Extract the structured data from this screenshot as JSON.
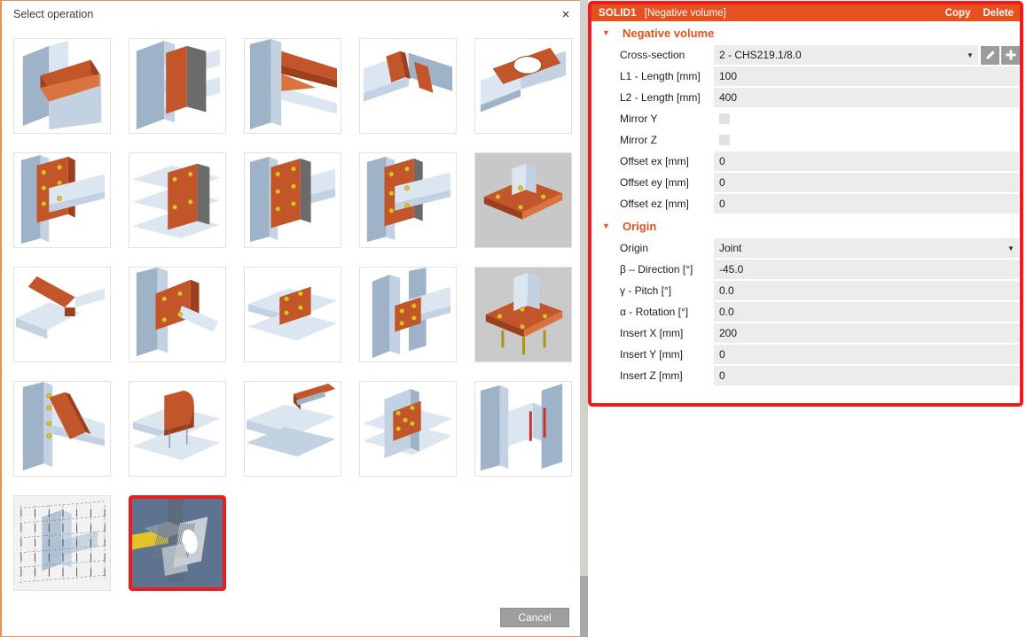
{
  "dialog": {
    "title": "Select operation",
    "close_label": "×",
    "cancel_label": "Cancel",
    "thumbnails": [
      {
        "id": "cut-beam-by-beam",
        "name": "cut-beam-by-beam",
        "selected": false
      },
      {
        "id": "plate-to-web",
        "name": "plate-to-web",
        "selected": false
      },
      {
        "id": "haunch-stiffener",
        "name": "haunch-stiffener",
        "selected": false
      },
      {
        "id": "stiffener-pair",
        "name": "stiffener-pair",
        "selected": false
      },
      {
        "id": "opening-in-web",
        "name": "opening-in-web",
        "selected": false
      },
      {
        "id": "end-plate-bolted",
        "name": "end-plate-bolted",
        "selected": false
      },
      {
        "id": "fin-plate-double",
        "name": "fin-plate-double",
        "selected": false
      },
      {
        "id": "bolted-splice-plate",
        "name": "bolted-splice-plate",
        "selected": false
      },
      {
        "id": "end-plate-column",
        "name": "end-plate-column",
        "selected": false
      },
      {
        "id": "base-plate-anchors",
        "name": "base-plate-anchors",
        "selected": false
      },
      {
        "id": "diagonal-gusset",
        "name": "diagonal-gusset",
        "selected": false
      },
      {
        "id": "gusset-plate-brace",
        "name": "gusset-plate-brace",
        "selected": false
      },
      {
        "id": "flange-cleat",
        "name": "flange-cleat",
        "selected": false
      },
      {
        "id": "splice-bolted-web",
        "name": "splice-bolted-web",
        "selected": false
      },
      {
        "id": "column-base-plate",
        "name": "column-base-plate",
        "selected": false
      },
      {
        "id": "diagonal-stiffener",
        "name": "diagonal-stiffener",
        "selected": false
      },
      {
        "id": "curved-end-plate",
        "name": "curved-end-plate",
        "selected": false
      },
      {
        "id": "cap-plate",
        "name": "cap-plate",
        "selected": false
      },
      {
        "id": "bolted-crossing",
        "name": "bolted-crossing",
        "selected": false
      },
      {
        "id": "web-plate-pair",
        "name": "web-plate-pair",
        "selected": false
      },
      {
        "id": "mesh-model",
        "name": "mesh-model",
        "selected": false
      },
      {
        "id": "negative-volume",
        "name": "negative-volume",
        "selected": true
      }
    ]
  },
  "properties": {
    "header": {
      "id": "SOLID1",
      "type": "[Negative volume]",
      "copy_label": "Copy",
      "delete_label": "Delete"
    },
    "groups": [
      {
        "title": "Negative volume",
        "expanded": true,
        "rows": [
          {
            "label": "Cross-section",
            "value": "2 - CHS219.1/8.0",
            "type": "combo-buttons"
          },
          {
            "label": "L1 - Length [mm]",
            "value": "100",
            "type": "text"
          },
          {
            "label": "L2 - Length [mm]",
            "value": "400",
            "type": "text"
          },
          {
            "label": "Mirror Y",
            "value": "",
            "type": "checkbox",
            "checked": false
          },
          {
            "label": "Mirror Z",
            "value": "",
            "type": "checkbox",
            "checked": false
          },
          {
            "label": "Offset ex [mm]",
            "value": "0",
            "type": "text"
          },
          {
            "label": "Offset ey [mm]",
            "value": "0",
            "type": "text"
          },
          {
            "label": "Offset ez [mm]",
            "value": "0",
            "type": "text"
          }
        ]
      },
      {
        "title": "Origin",
        "expanded": true,
        "rows": [
          {
            "label": "Origin",
            "value": "Joint",
            "type": "combo"
          },
          {
            "label": "β – Direction [°]",
            "value": "-45.0",
            "type": "text"
          },
          {
            "label": "γ - Pitch [°]",
            "value": "0.0",
            "type": "text"
          },
          {
            "label": "α - Rotation [°]",
            "value": "0.0",
            "type": "text"
          },
          {
            "label": "Insert X [mm]",
            "value": "200",
            "type": "text"
          },
          {
            "label": "Insert Y [mm]",
            "value": "0",
            "type": "text"
          },
          {
            "label": "Insert Z [mm]",
            "value": "0",
            "type": "text"
          }
        ]
      }
    ],
    "caret_glyph": "▼",
    "combo_arrow_glyph": "▼"
  },
  "colors": {
    "accent_orange": "#e6521f",
    "highlight_red": "#ee1c1c",
    "field_gray": "#ececec",
    "button_gray": "#9e9e9e",
    "dialog_border": "#e0935a"
  }
}
